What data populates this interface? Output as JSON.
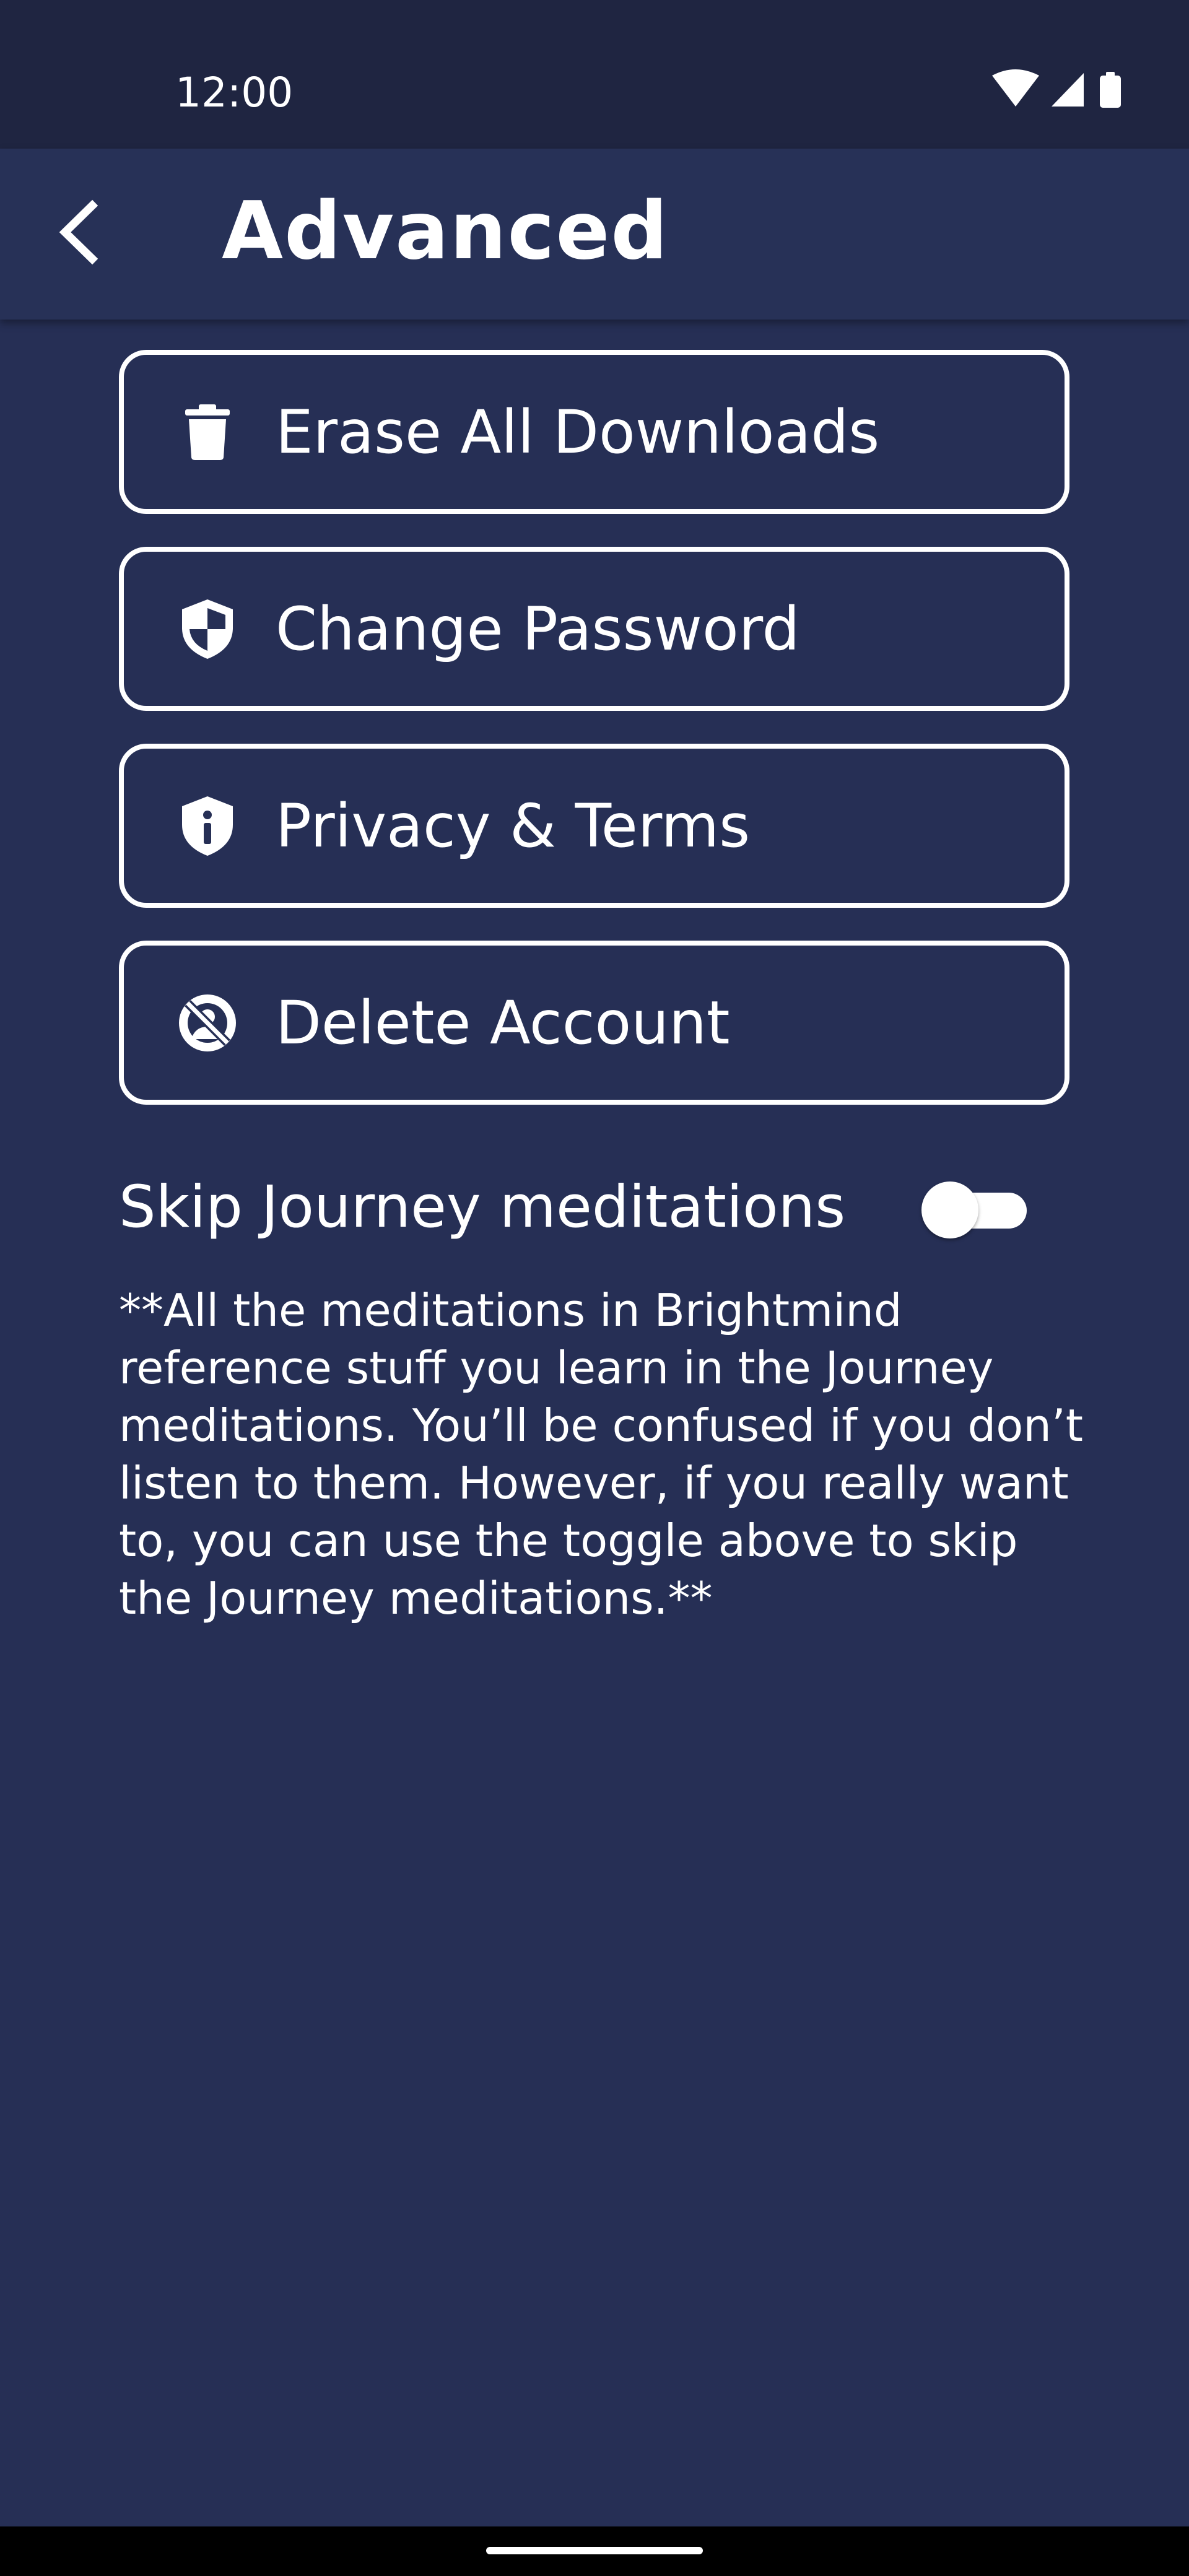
{
  "status_bar": {
    "time": "12:00",
    "icons": [
      "wifi-icon",
      "cell-signal-icon",
      "battery-icon"
    ]
  },
  "header": {
    "title": "Advanced",
    "back_icon": "chevron-left-icon"
  },
  "actions": [
    {
      "label": "Erase All Downloads",
      "icon": "trash-icon"
    },
    {
      "label": "Change Password",
      "icon": "shield-half-icon"
    },
    {
      "label": "Privacy & Terms",
      "icon": "shield-info-icon"
    },
    {
      "label": "Delete Account",
      "icon": "no-account-icon"
    }
  ],
  "skip_journey": {
    "label": "Skip Journey meditations",
    "enabled": false
  },
  "note": "**All the meditations in Brightmind reference stuff you learn in the Journey meditations. You’ll be confused if you don’t listen to them. However, if you really want to, you can use the toggle above to skip the Journey meditations.**",
  "colors": {
    "background": "#262f55",
    "app_bar": "#273157",
    "status_bar": "#1f2541",
    "foreground": "#ffffff"
  }
}
